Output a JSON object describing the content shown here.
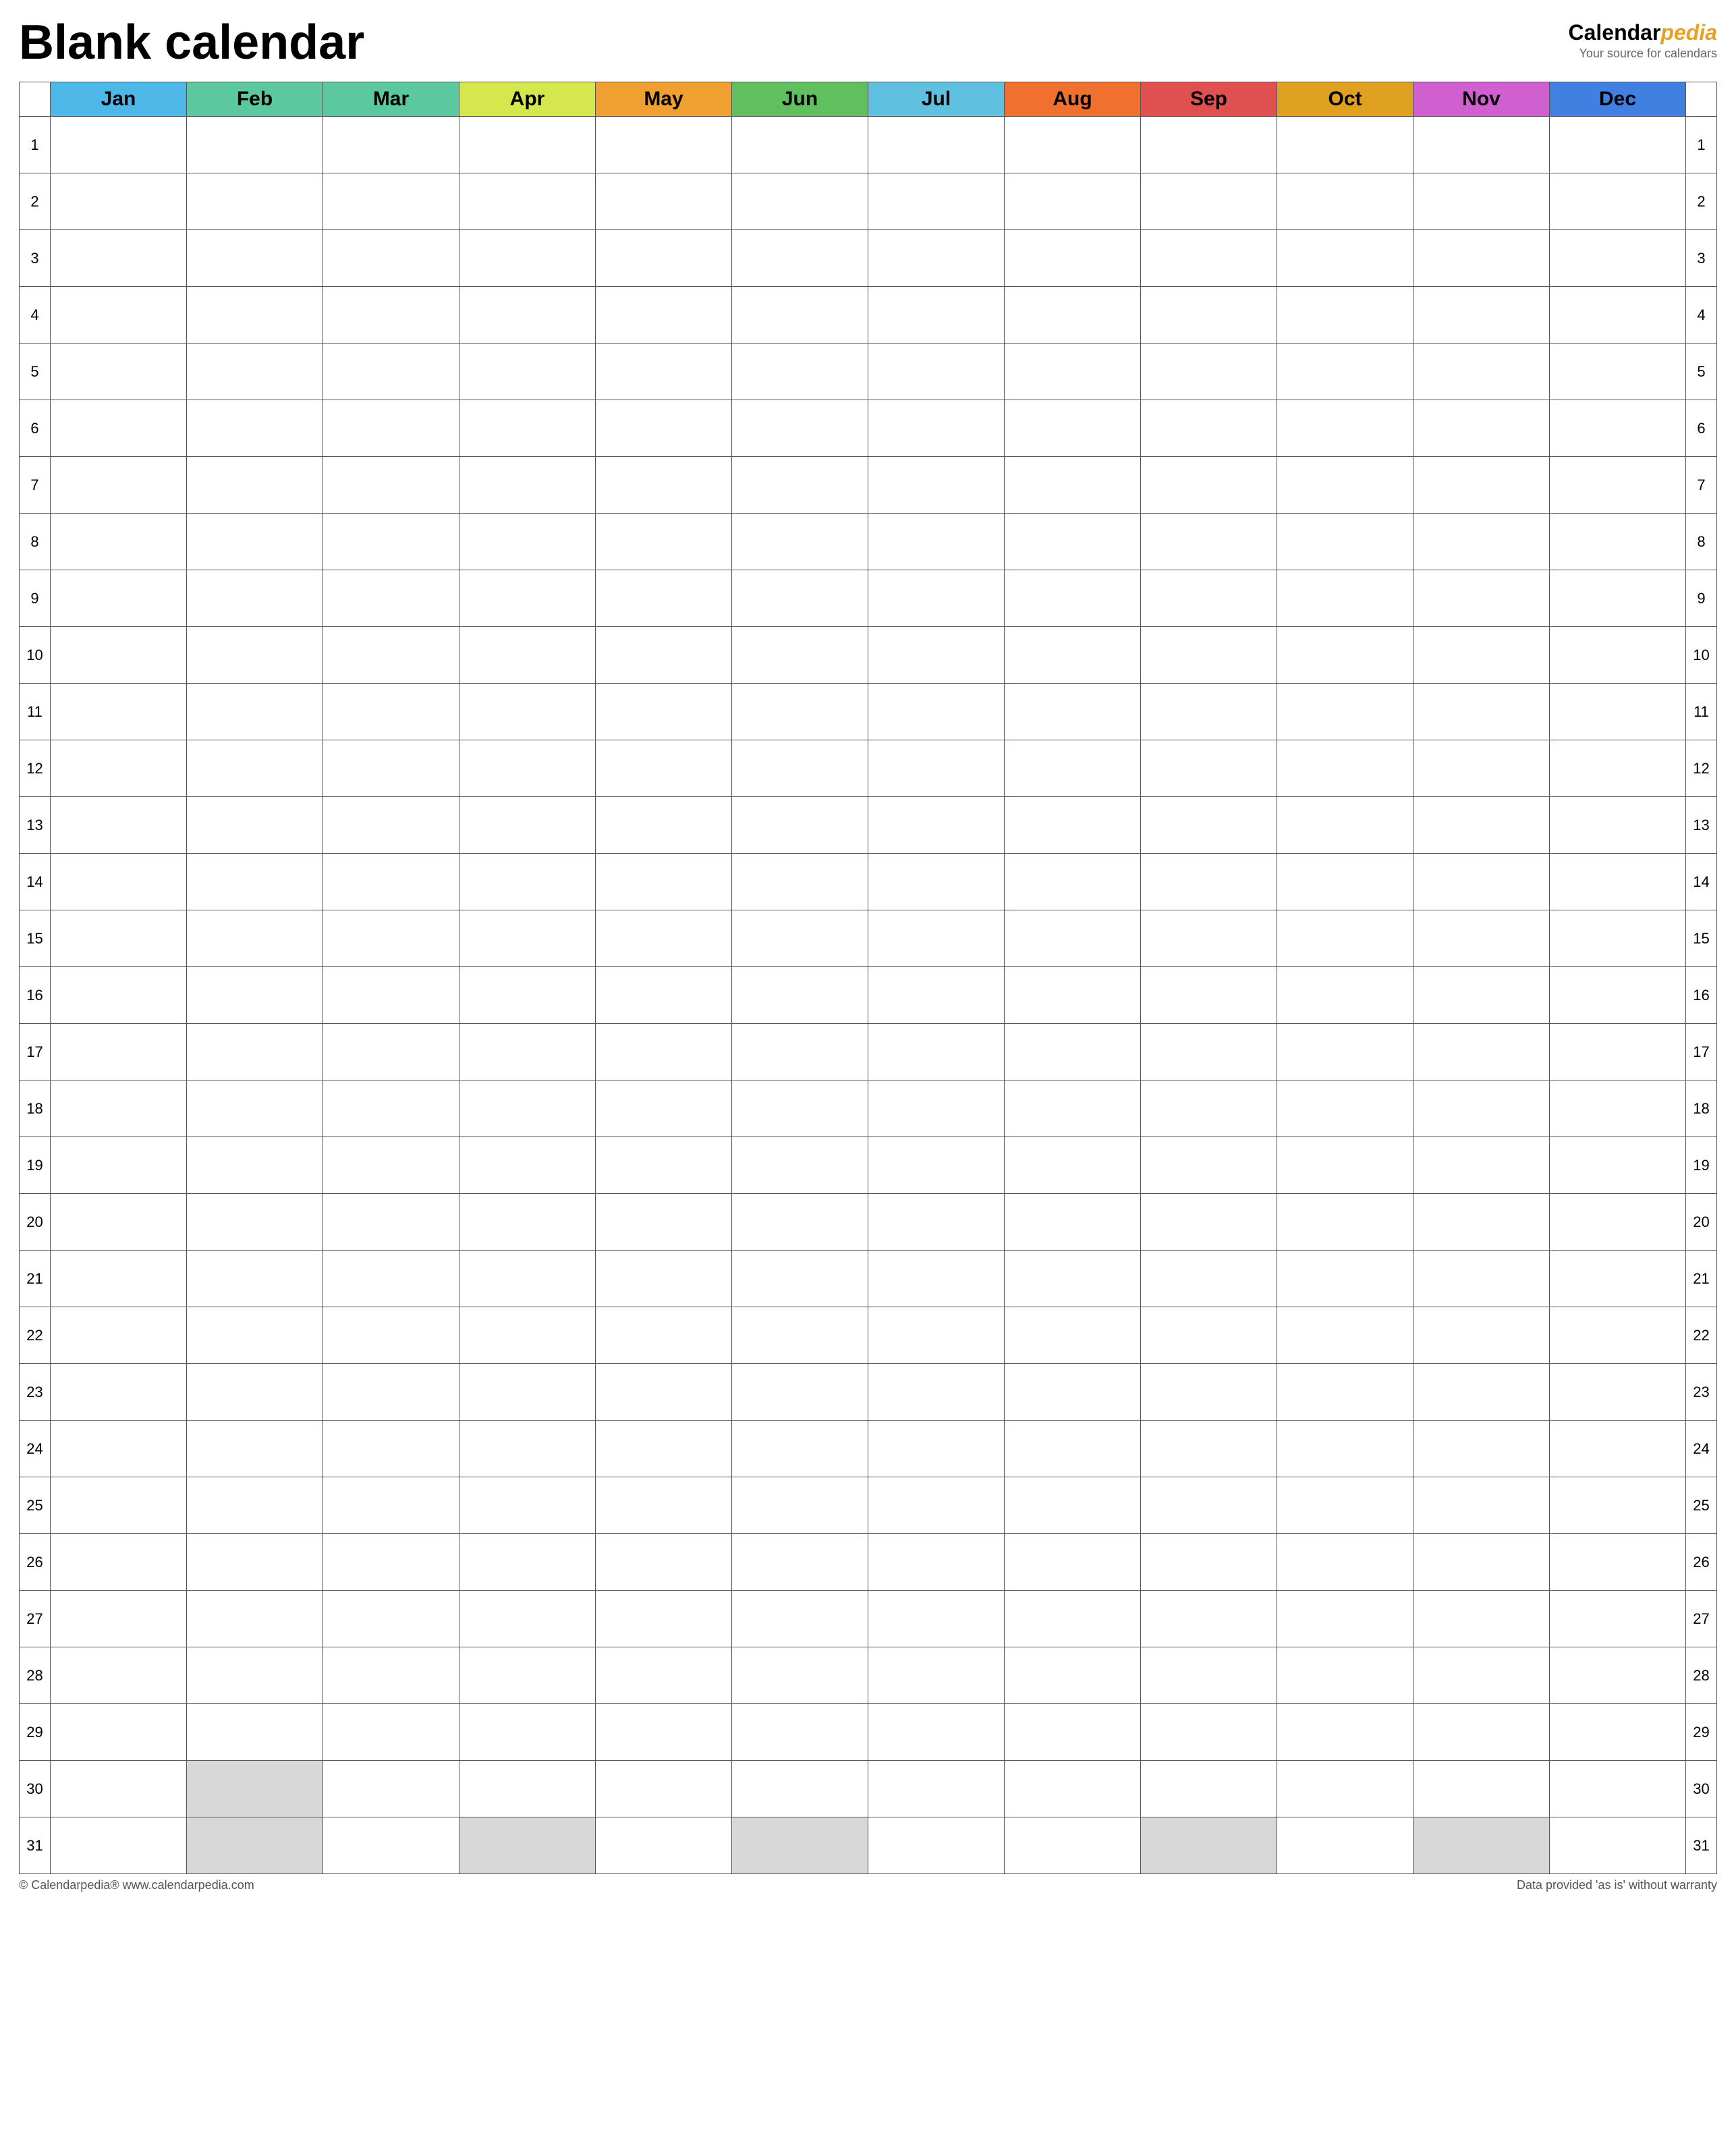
{
  "header": {
    "title": "Blank calendar",
    "logo_calendar": "Calendar",
    "logo_pedia": "pedia",
    "logo_sub": "Your source for calendars"
  },
  "months": [
    {
      "label": "Jan",
      "class": "month-jan"
    },
    {
      "label": "Feb",
      "class": "month-feb"
    },
    {
      "label": "Mar",
      "class": "month-mar"
    },
    {
      "label": "Apr",
      "class": "month-apr"
    },
    {
      "label": "May",
      "class": "month-may"
    },
    {
      "label": "Jun",
      "class": "month-jun"
    },
    {
      "label": "Jul",
      "class": "month-jul"
    },
    {
      "label": "Aug",
      "class": "month-aug"
    },
    {
      "label": "Sep",
      "class": "month-sep"
    },
    {
      "label": "Oct",
      "class": "month-oct"
    },
    {
      "label": "Nov",
      "class": "month-nov"
    },
    {
      "label": "Dec",
      "class": "month-dec"
    }
  ],
  "days": [
    1,
    2,
    3,
    4,
    5,
    6,
    7,
    8,
    9,
    10,
    11,
    12,
    13,
    14,
    15,
    16,
    17,
    18,
    19,
    20,
    21,
    22,
    23,
    24,
    25,
    26,
    27,
    28,
    29,
    30,
    31
  ],
  "greyed_cells": {
    "30": [
      1
    ],
    "31": [
      1,
      3,
      5,
      8,
      10
    ]
  },
  "footer": {
    "left": "© Calendarpedia®  www.calendarpedia.com",
    "right": "Data provided 'as is' without warranty"
  }
}
